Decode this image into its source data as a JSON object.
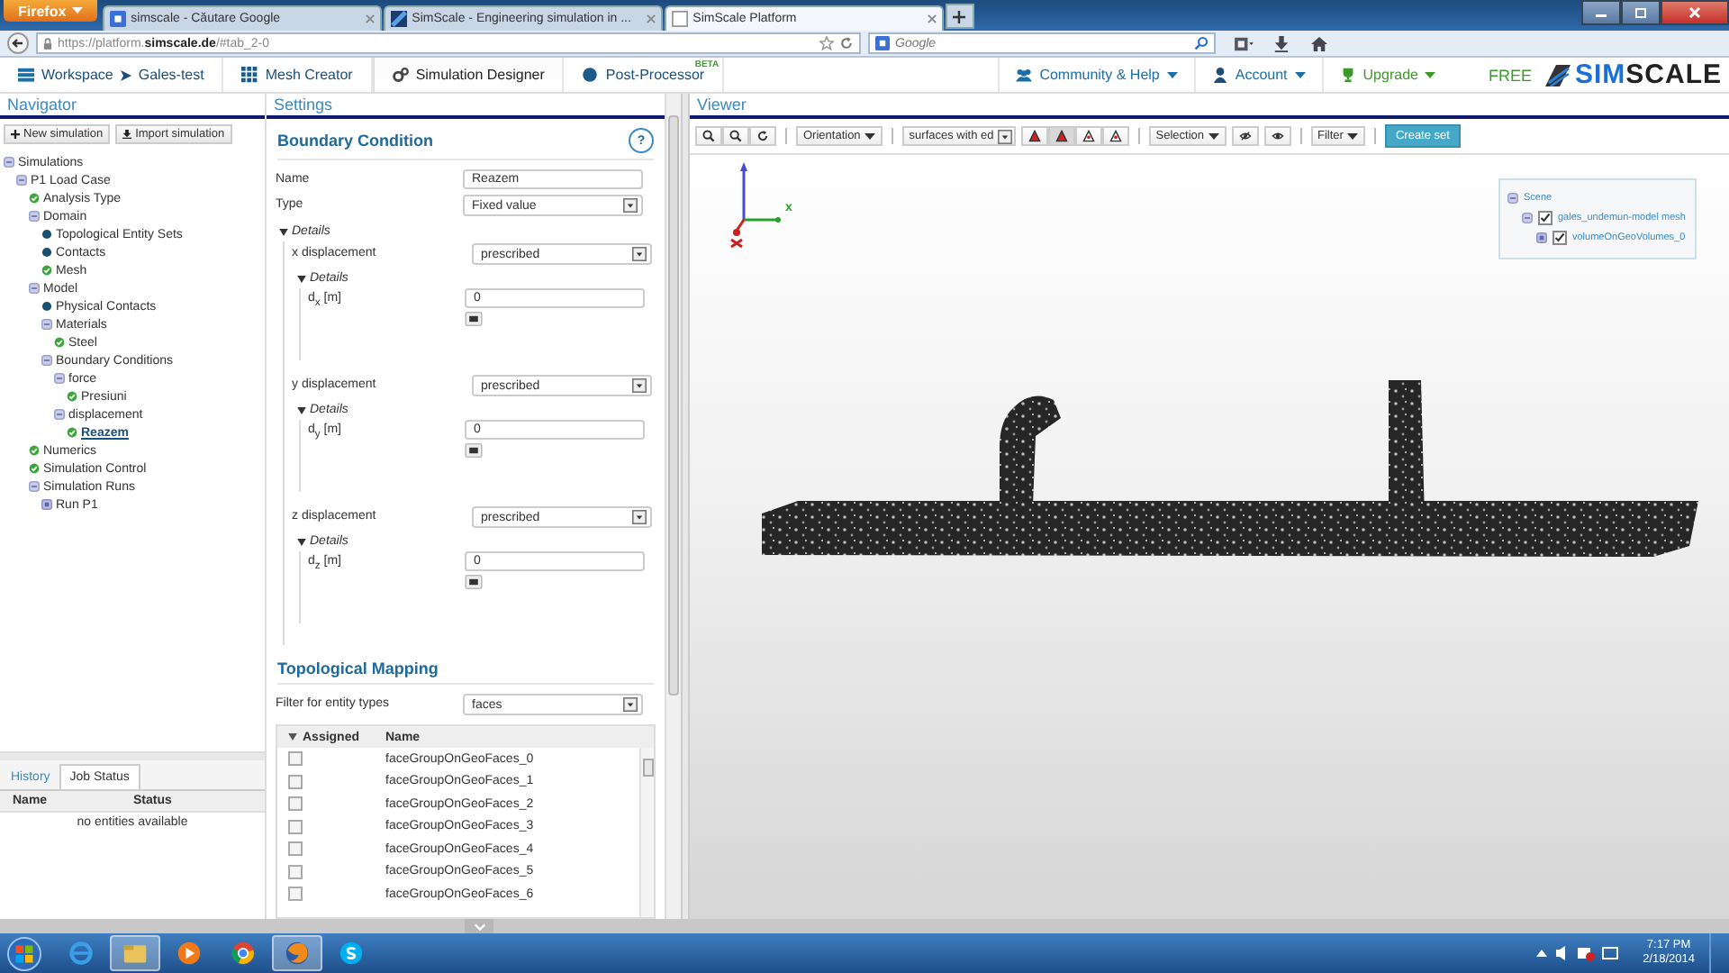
{
  "browser": {
    "menu_button": "Firefox",
    "tabs": [
      {
        "title": "simscale - Căutare Google",
        "selected": false
      },
      {
        "title": "SimScale - Engineering simulation in ...",
        "selected": false
      },
      {
        "title": "SimScale Platform",
        "selected": true
      }
    ],
    "url": "https://platform.**simscale.de**/#tab_2-0",
    "search_placeholder": "Google"
  },
  "app_nav": {
    "left": [
      {
        "label": "Workspace",
        "sub": "Gales-test",
        "selected": false
      },
      {
        "label": "Mesh Creator",
        "selected": false
      },
      {
        "label": "Simulation Designer",
        "selected": true
      },
      {
        "label": "Post-Processor",
        "badge": "BETA",
        "selected": false
      }
    ],
    "right": [
      {
        "label": "Community & Help",
        "color": "#1b6ea8"
      },
      {
        "label": "Account",
        "color": "#1b6ea8"
      },
      {
        "label": "Upgrade",
        "color": "#3c9a2a"
      }
    ],
    "plan": "FREE",
    "logo": [
      "SIM",
      "SCALE"
    ]
  },
  "navigator": {
    "title": "Navigator",
    "buttons": [
      "New simulation",
      "Import simulation"
    ],
    "tree": [
      {
        "label": "Simulations",
        "kind": "group",
        "selected": false,
        "children": [
          {
            "label": "P1 Load Case",
            "kind": "group",
            "selected": false,
            "children": [
              {
                "label": "Analysis Type",
                "kind": "ok",
                "selected": false
              },
              {
                "label": "Domain",
                "kind": "group",
                "selected": false,
                "children": [
                  {
                    "label": "Topological Entity Sets",
                    "kind": "dot",
                    "selected": false
                  },
                  {
                    "label": "Contacts",
                    "kind": "dot",
                    "selected": false
                  },
                  {
                    "label": "Mesh",
                    "kind": "ok",
                    "selected": false
                  }
                ]
              },
              {
                "label": "Model",
                "kind": "group",
                "selected": false,
                "children": [
                  {
                    "label": "Physical Contacts",
                    "kind": "dot",
                    "selected": false
                  },
                  {
                    "label": "Materials",
                    "kind": "group",
                    "selected": false,
                    "children": [
                      {
                        "label": "Steel",
                        "kind": "ok",
                        "selected": false
                      }
                    ]
                  },
                  {
                    "label": "Boundary Conditions",
                    "kind": "group",
                    "selected": false,
                    "children": [
                      {
                        "label": "force",
                        "kind": "group",
                        "selected": false,
                        "children": [
                          {
                            "label": "Presiuni",
                            "kind": "ok",
                            "selected": false
                          }
                        ]
                      },
                      {
                        "label": "displacement",
                        "kind": "group",
                        "selected": false,
                        "children": [
                          {
                            "label": "Reazem",
                            "kind": "ok",
                            "selected": true
                          }
                        ]
                      }
                    ]
                  }
                ]
              },
              {
                "label": "Numerics",
                "kind": "ok",
                "selected": false
              },
              {
                "label": "Simulation Control",
                "kind": "ok",
                "selected": false
              },
              {
                "label": "Simulation Runs",
                "kind": "group",
                "selected": false,
                "children": [
                  {
                    "label": "Run P1",
                    "kind": "run",
                    "selected": false
                  }
                ]
              }
            ]
          }
        ]
      }
    ],
    "bottom_tabs": [
      {
        "label": "History",
        "selected": false
      },
      {
        "label": "Job Status",
        "selected": true
      }
    ],
    "columns": [
      "Name",
      "Status"
    ],
    "empty_message": "no entities available"
  },
  "settings": {
    "title": "Settings",
    "section": "Boundary Condition",
    "help": "?",
    "name_label": "Name",
    "name_value": "Reazem",
    "type_label": "Type",
    "type_value": "Fixed value",
    "details_label": "Details",
    "displacements": [
      {
        "label": "x displacement",
        "value": "prescribed",
        "details_label": "Details",
        "field_label": "d$_{x}$ [m]",
        "field_value": "0"
      },
      {
        "label": "y displacement",
        "value": "prescribed",
        "details_label": "Details",
        "field_label": "d$_{y}$ [m]",
        "field_value": "0"
      },
      {
        "label": "z displacement",
        "value": "prescribed",
        "details_label": "Details",
        "field_label": "d$_{z}$ [m]",
        "field_value": "0"
      }
    ],
    "mapping_title": "Topological Mapping",
    "filter_label": "Filter for entity types",
    "filter_value": "faces",
    "columns": [
      "Assigned",
      "Name"
    ],
    "rows": [
      {
        "name": "faceGroupOnGeoFaces_0",
        "checked": false
      },
      {
        "name": "faceGroupOnGeoFaces_1",
        "checked": false
      },
      {
        "name": "faceGroupOnGeoFaces_2",
        "checked": false
      },
      {
        "name": "faceGroupOnGeoFaces_3",
        "checked": false
      },
      {
        "name": "faceGroupOnGeoFaces_4",
        "checked": false
      },
      {
        "name": "faceGroupOnGeoFaces_5",
        "checked": false
      },
      {
        "name": "faceGroupOnGeoFaces_6",
        "checked": false
      }
    ]
  },
  "viewer": {
    "title": "Viewer",
    "orientation": "Orientation",
    "render_value": "surfaces with ed",
    "render_modes": [
      {
        "selected": false
      },
      {
        "selected": true
      },
      {
        "selected": false
      },
      {
        "selected": false
      }
    ],
    "selection": "Selection",
    "filter": "Filter",
    "create_set": "Create set",
    "axis_label": "x",
    "scene": {
      "label": "Scene",
      "children": [
        {
          "label": "gales_undemun-model mesh",
          "checked": true,
          "children": [
            {
              "label": "volumeOnGeoVolumes_0",
              "checked": true
            }
          ]
        }
      ]
    }
  },
  "taskbar": {
    "apps": [
      {
        "selected": false
      },
      {
        "selected": true
      },
      {
        "selected": false
      },
      {
        "selected": false
      },
      {
        "selected": true
      },
      {
        "selected": false
      }
    ],
    "time": "7:17 PM",
    "date": "2/18/2014"
  }
}
